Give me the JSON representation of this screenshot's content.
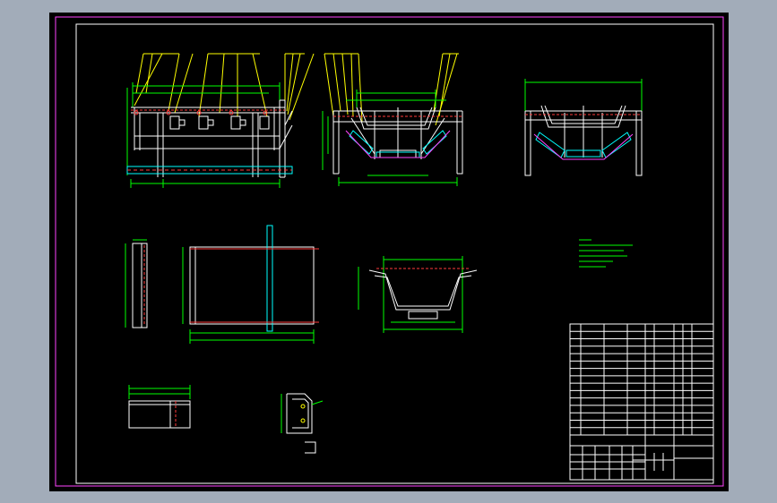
{
  "drawing": {
    "colors": {
      "viewport_background": "#a2acb9",
      "paper": "#000000",
      "border_outer": "#ff44ff",
      "border_inner": "#ffffff",
      "outline": "#ffffff",
      "dimension": "#00ff00",
      "leader": "#ffff00",
      "hidden": "#ff3b3b",
      "section": "#00ffff"
    },
    "notes_text": [],
    "title_block_text": []
  }
}
